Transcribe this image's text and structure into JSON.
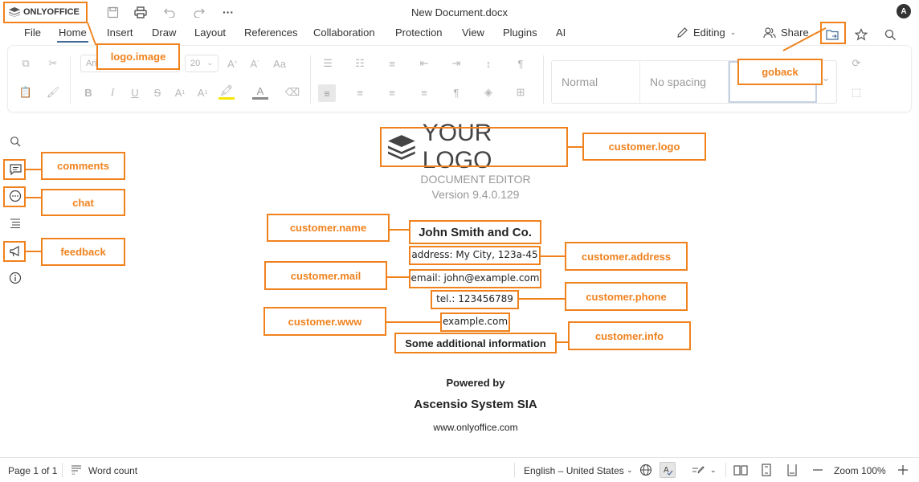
{
  "window": {
    "logo_text": "ONLYOFFICE",
    "doc_title": "New Document.docx",
    "avatar": "A"
  },
  "menu": {
    "tabs": [
      "File",
      "Home",
      "Insert",
      "Draw",
      "Layout",
      "References",
      "Collaboration",
      "Protection",
      "View",
      "Plugins",
      "AI"
    ],
    "active": "Home",
    "editing_label": "Editing",
    "share_label": "Share"
  },
  "toolbar": {
    "font_name": "Ari",
    "font_size": "20",
    "styles": [
      "Normal",
      "No spacing",
      ""
    ]
  },
  "annotations": {
    "logo_image": "logo.image",
    "goback": "goback",
    "customer_logo": "customer.logo",
    "comments": "comments",
    "chat": "chat",
    "feedback": "feedback",
    "customer_name": "customer.name",
    "customer_address": "customer.address",
    "customer_mail": "customer.mail",
    "customer_phone": "customer.phone",
    "customer_www": "customer.www",
    "customer_info": "customer.info"
  },
  "about": {
    "logo_text": "YOUR LOGO",
    "product": "DOCUMENT EDITOR",
    "version": "Version 9.4.0.129",
    "name": "John Smith and Co.",
    "address": "address: My City, 123a-45",
    "mail": "email: john@example.com",
    "phone": "tel.: 123456789",
    "www": "example.com",
    "info": "Some additional information",
    "powered_by": "Powered by",
    "publisher": "Ascensio System SIA",
    "publisher_url": "www.onlyoffice.com"
  },
  "status": {
    "page": "Page 1 of 1",
    "word_count": "Word count",
    "language": "English – United States",
    "zoom": "Zoom 100%"
  },
  "colors": {
    "annotation": "#f0821e",
    "accent": "#446995"
  }
}
